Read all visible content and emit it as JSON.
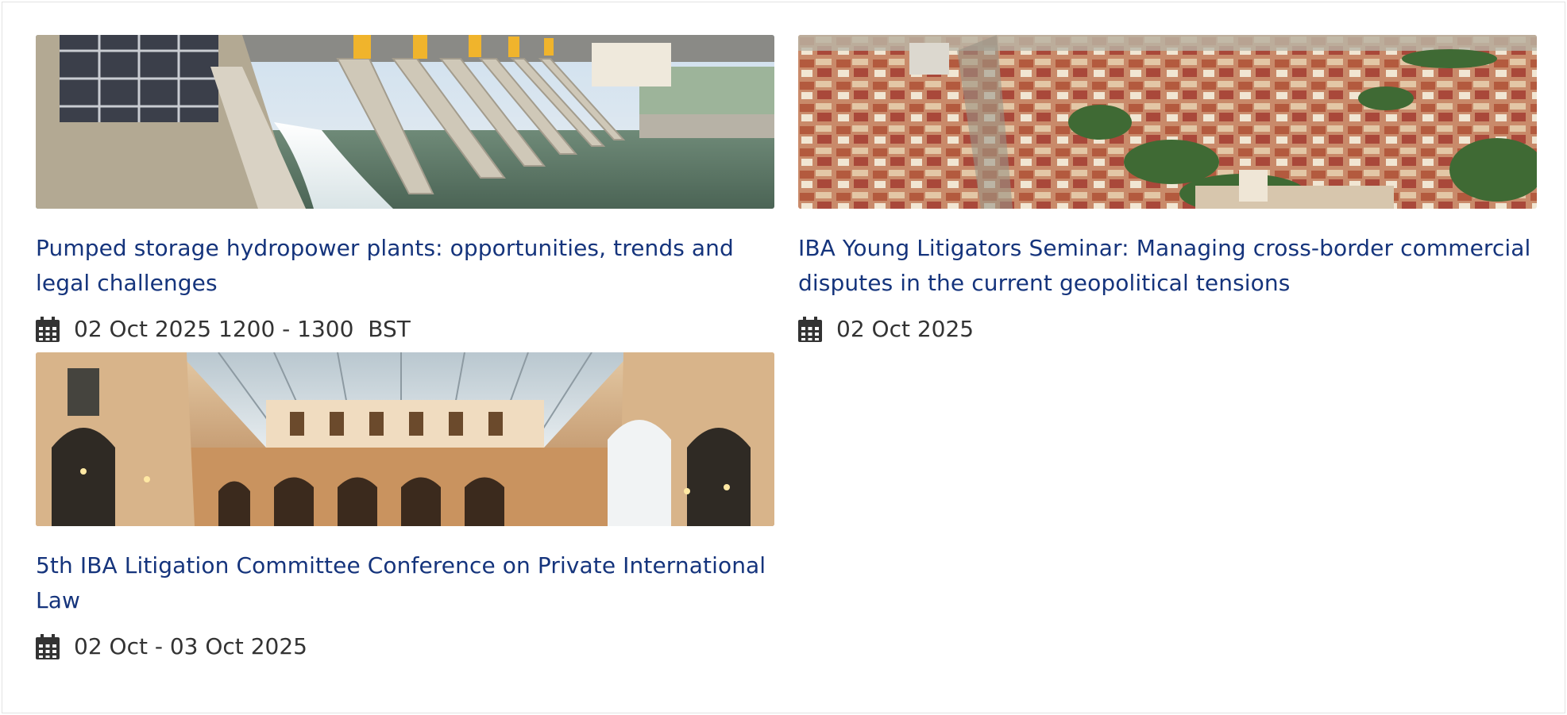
{
  "events": [
    {
      "title": "Pumped storage hydropower plants: opportunities, trends and legal challenges",
      "date": "02 Oct 2025 1200 - 1300  BST",
      "image_subject": "hydropower dam spillway",
      "icon": "calendar-icon"
    },
    {
      "title": "IBA Young Litigators Seminar: Managing cross-border commercial disputes in the current geopolitical tensions",
      "date": "02 Oct 2025",
      "image_subject": "aerial city rooftops",
      "icon": "calendar-icon"
    },
    {
      "title": "5th IBA Litigation Committee Conference on Private International Law",
      "date": "02 Oct - 03 Oct 2025",
      "image_subject": "glass-roofed shopping gallery",
      "icon": "calendar-icon"
    }
  ],
  "colors": {
    "title": "#15347c",
    "meta_text": "#333333",
    "border": "#e2e2e2"
  }
}
